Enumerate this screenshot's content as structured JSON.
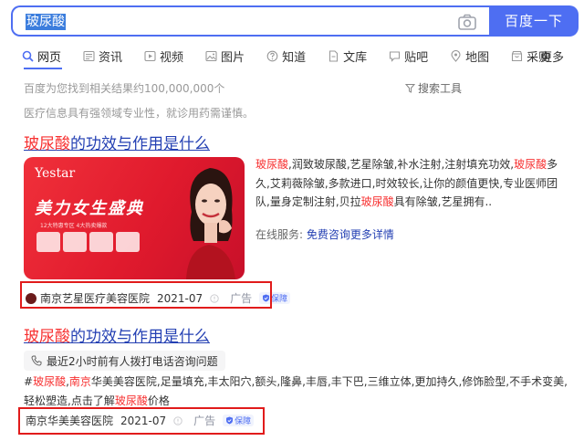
{
  "search": {
    "query": "玻尿酸",
    "button_label": "百度一下"
  },
  "tabs": [
    {
      "label": "网页",
      "icon": "search-icon",
      "active": true
    },
    {
      "label": "资讯",
      "icon": "news-icon"
    },
    {
      "label": "视频",
      "icon": "video-icon"
    },
    {
      "label": "图片",
      "icon": "image-icon"
    },
    {
      "label": "知道",
      "icon": "question-icon"
    },
    {
      "label": "文库",
      "icon": "doc-icon"
    },
    {
      "label": "贴吧",
      "icon": "tieba-icon"
    },
    {
      "label": "地图",
      "icon": "map-pin-icon"
    },
    {
      "label": "采购",
      "icon": "shop-icon"
    }
  ],
  "tabs_more": "更多",
  "result_count": "百度为您找到相关结果约100,000,000个",
  "search_tools": "搜索工具",
  "notice": "医疗信息具有强领域专业性，就诊用药需谨慎。",
  "result1": {
    "title_hl": "玻尿酸",
    "title_rest": "的功效与作用是什么",
    "ad_image": {
      "brand": "Yestar",
      "headline": "美力女生盛典",
      "sub": "12大特惠专区  4大热卖爆款"
    },
    "desc": [
      {
        "t": "玻尿酸",
        "hl": true
      },
      {
        "t": ",润致玻尿酸,艺星除皱,补水注射,注射填充功效,"
      },
      {
        "t": "玻尿酸",
        "hl": true
      },
      {
        "t": "多久,艾莉薇除皱,多款进口,时效较长,让你的颜值更快,专业医师团队,量身定制注射,贝拉"
      },
      {
        "t": "玻尿酸",
        "hl": true
      },
      {
        "t": "具有除皱,艺星拥有.."
      }
    ],
    "service_label": "在线服务:",
    "service_link": "免费咨询更多详情",
    "source": "南京艺星医疗美容医院",
    "date": "2021-07",
    "ad_tag": "广告",
    "badge": "保障"
  },
  "result2": {
    "title_hl": "玻尿酸",
    "title_rest": "的功效与作用是什么",
    "call_notice": "最近2小时前有人拨打电话咨询问题",
    "desc": [
      {
        "t": "#"
      },
      {
        "t": "玻尿酸",
        "hl": true
      },
      {
        "t": ","
      },
      {
        "t": "南京",
        "hl": true
      },
      {
        "t": "华美美容医院,足量填充,丰太阳穴,额头,隆鼻,丰唇,丰下巴,三维立体,更加持久,修饰脸型,不手术变美,轻松塑造,点击了解"
      },
      {
        "t": "玻尿酸",
        "hl": true
      },
      {
        "t": "价格"
      }
    ],
    "source": "南京华美美容医院",
    "date": "2021-07",
    "ad_tag": "广告",
    "badge": "保障"
  },
  "colors": {
    "brand_blue": "#4e6ef2",
    "title_blue": "#2440b3",
    "highlight_red": "#f73131",
    "annotation_red": "#e11b1b"
  }
}
